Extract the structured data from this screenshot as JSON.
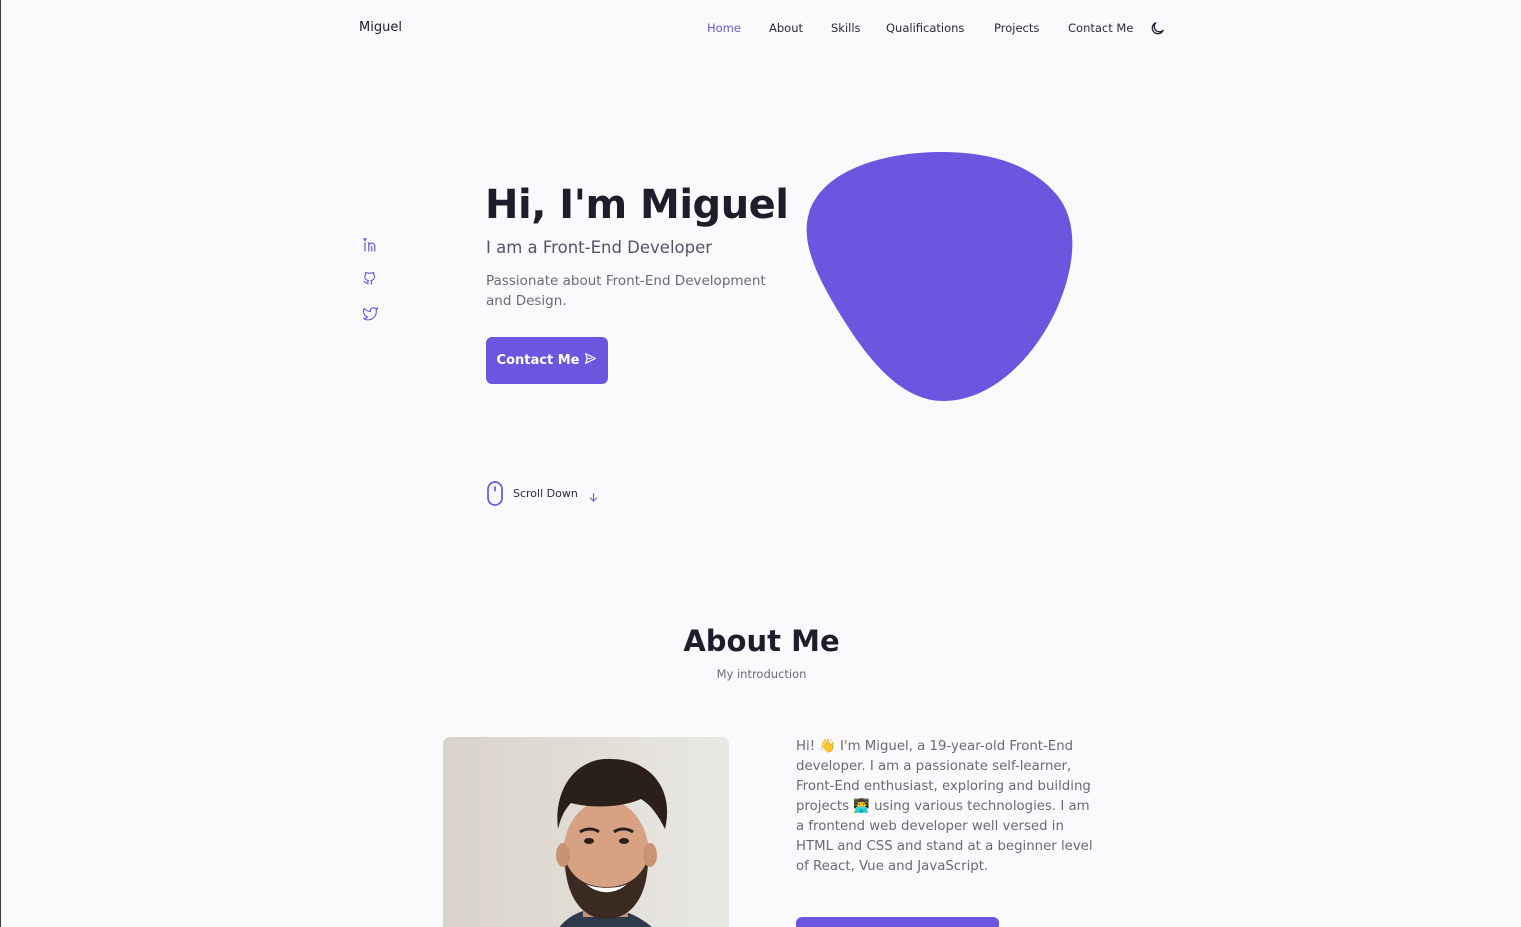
{
  "header": {
    "logo": "Miguel",
    "nav": [
      {
        "label": "Home",
        "active": true
      },
      {
        "label": "About",
        "active": false
      },
      {
        "label": "Skills",
        "active": false
      },
      {
        "label": "Qualifications",
        "active": false
      },
      {
        "label": "Projects",
        "active": false
      },
      {
        "label": "Contact Me",
        "active": false
      }
    ],
    "theme_icon": "moon-icon"
  },
  "social": [
    {
      "icon": "linkedin-icon"
    },
    {
      "icon": "github-icon"
    },
    {
      "icon": "twitter-icon"
    }
  ],
  "hero": {
    "title": "Hi, I'm Miguel",
    "subtitle": "I am a Front-End Developer",
    "description": "Passionate about Front-End Development and Design.",
    "button_label": "Contact Me",
    "button_icon": "send-icon"
  },
  "scroll": {
    "label": "Scroll Down",
    "icon": "mouse-icon",
    "arrow_icon": "arrow-down-icon"
  },
  "about": {
    "title": "About Me",
    "subtitle": "My introduction",
    "text": "Hi! 👋 I'm Miguel, a 19-year-old Front-End developer. I am a passionate self-learner, Front-End enthusiast, exploring and building projects 👨‍💻 using various technologies. I am a frontend web developer well versed in HTML and CSS and stand at a beginner level of React, Vue and JavaScript."
  },
  "colors": {
    "accent": "#6b57df",
    "background": "#fafafc",
    "text": "#1f1d2b",
    "muted": "#6b6a7a"
  }
}
